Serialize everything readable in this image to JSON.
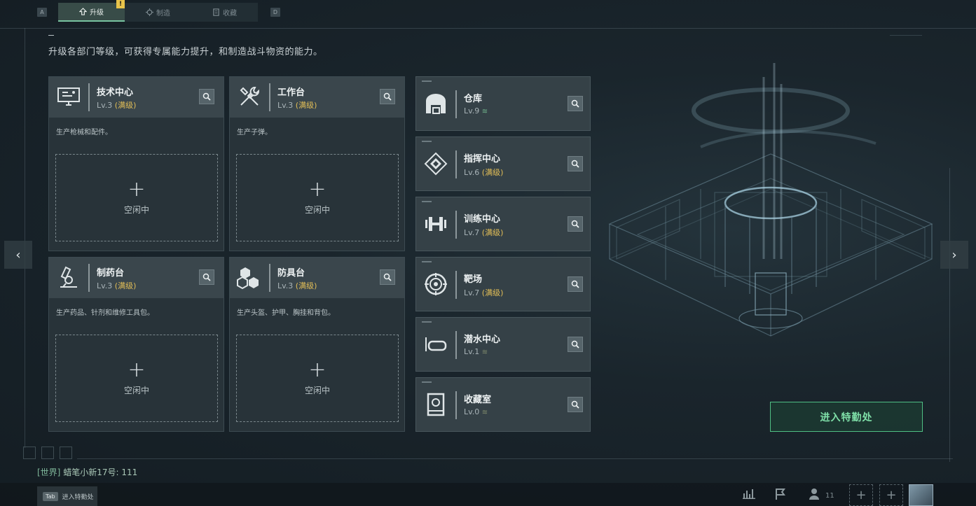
{
  "tabs": {
    "left_key": "A",
    "right_key": "D",
    "items": [
      {
        "label": "升级",
        "icon": "upgrade-icon",
        "active": true,
        "badge": "!"
      },
      {
        "label": "制造",
        "icon": "craft-icon",
        "active": false
      },
      {
        "label": "收藏",
        "icon": "collection-icon",
        "active": false
      }
    ]
  },
  "subtitle": "升级各部门等级，可获得专属能力提升，和制造战斗物资的能力。",
  "production_stations": [
    {
      "name": "技术中心",
      "level": "Lv.3",
      "max": "(满级)",
      "desc": "生产枪械和配件。",
      "slot": "空闲中",
      "icon": "computer-icon"
    },
    {
      "name": "工作台",
      "level": "Lv.3",
      "max": "(满级)",
      "desc": "生产子弹。",
      "slot": "空闲中",
      "icon": "tools-icon"
    },
    {
      "name": "制药台",
      "level": "Lv.3",
      "max": "(满级)",
      "desc": "生产药品、针剂和维修工具包。",
      "slot": "空闲中",
      "icon": "microscope-icon"
    },
    {
      "name": "防具台",
      "level": "Lv.3",
      "max": "(满级)",
      "desc": "生产头盔、护甲、胸挂和背包。",
      "slot": "空闲中",
      "icon": "armor-blocks-icon"
    }
  ],
  "departments": [
    {
      "name": "仓库",
      "level": "Lv.9",
      "max": "",
      "upgradable": true,
      "icon": "warehouse-icon"
    },
    {
      "name": "指挥中心",
      "level": "Lv.6",
      "max": "(满级)",
      "upgradable": false,
      "icon": "command-chip-icon"
    },
    {
      "name": "训练中心",
      "level": "Lv.7",
      "max": "(满级)",
      "upgradable": false,
      "icon": "dumbbell-icon"
    },
    {
      "name": "靶场",
      "level": "Lv.7",
      "max": "(满级)",
      "upgradable": false,
      "icon": "target-icon"
    },
    {
      "name": "潜水中心",
      "level": "Lv.1",
      "max": "",
      "upgradable": true,
      "icon": "diving-mask-icon"
    },
    {
      "name": "收藏室",
      "level": "Lv.0",
      "max": "",
      "upgradable": true,
      "icon": "collection-room-icon"
    }
  ],
  "enter_button": "进入特勤处",
  "chat": {
    "channel": "[世界]",
    "sender": "蜡笔小新17号",
    "message": "111"
  },
  "bottom": {
    "tab_key": "Tab",
    "tab_label": "进入特勤处",
    "friend_count": "11"
  },
  "colors": {
    "accent_green": "#4fbf84",
    "max_level": "#e2be57",
    "badge": "#e8c34a"
  }
}
